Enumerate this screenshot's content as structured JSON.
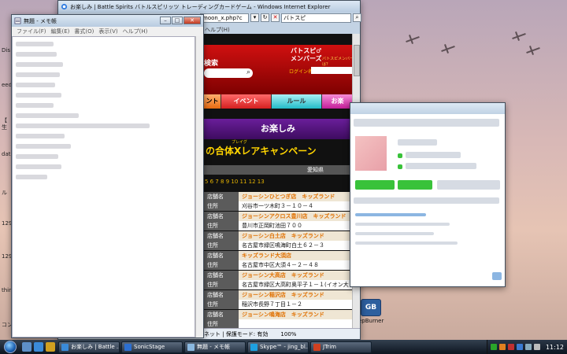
{
  "desktop": {
    "left_labels": [
      "Dis",
      "eed",
      "【",
      "生",
      "dat",
      "ル",
      "129",
      "129",
      "thin",
      "コン"
    ],
    "right_labels": [
      "GB",
      "epBurner"
    ]
  },
  "ie": {
    "title": "お楽しみ | Battle Spirits バトルスピリッツ トレーディングカードゲーム - Windows Internet Explorer",
    "url_tail": "moon_x.php?c",
    "search_tab": "バトスピ",
    "menu_help": "ヘルプ(H)",
    "banner_search": "検索",
    "member_title": "バトスピ♂",
    "member_subtitle": "メンバーズ",
    "member_link": "バトスピメンバーズとは？",
    "login_label": "ログイン名",
    "nav": [
      "ント",
      "イベント",
      "ルール",
      "お楽"
    ],
    "section_title": "お楽しみ",
    "campaign_ruby": "プレイグ",
    "campaign_title": "の合体Xレアキャンペーン",
    "area_header": "愛知県",
    "pages": "5 6 7 8 9 10 11 12 13",
    "stores": [
      {
        "k1": "店舗名",
        "name": "ジョーシンひとつぎ店　キッズランド",
        "k2": "住所",
        "addr": "刈谷市一ツ木町３－１０－４"
      },
      {
        "k1": "店舗名",
        "name": "ジョーシンアクロス豊川店　キッズランド",
        "k2": "住所",
        "addr": "豊川市正岡町池田７００"
      },
      {
        "k1": "店舗名",
        "name": "ジョーシン白土店　キッズランド",
        "k2": "住所",
        "addr": "名古屋市緑区鳴海町白土６２－３"
      },
      {
        "k1": "店舗名",
        "name": "キッズランド大須店",
        "k2": "住所",
        "addr": "名古屋市中区大須４－２－４８"
      },
      {
        "k1": "店舗名",
        "name": "ジョーシン大高店　キッズランド",
        "k2": "住所",
        "addr": "名古屋市緑区大高町奥平子１－１(イオン大高"
      },
      {
        "k1": "店舗名",
        "name": "ジョーシン稲沢店　キッズランド",
        "k2": "住所",
        "addr": "稲沢市長野７丁目１－２"
      },
      {
        "k1": "店舗名",
        "name": "ジョーシン鳴海店　キッズランド",
        "k2": "住所",
        "addr": ""
      }
    ],
    "status_text": "ネット | 保護モード: 有効",
    "zoom": "100%"
  },
  "notepad": {
    "title": "無題 - メモ帳",
    "menu": [
      "ファイル(F)",
      "編集(E)",
      "書式(O)",
      "表示(V)",
      "ヘルプ(H)"
    ],
    "blur_lines": [
      48,
      52,
      60,
      56,
      50,
      58,
      48,
      80,
      170,
      62,
      70,
      54,
      58,
      40
    ]
  },
  "taskbar": {
    "tasks": [
      {
        "label": "お楽しみ | Battle ...",
        "color": "#3a8ad8"
      },
      {
        "label": "SonicStage",
        "color": "#2c6fd0"
      },
      {
        "label": "無題 - メモ帳",
        "color": "#8ab8e0"
      },
      {
        "label": "Skype™ - jing_bl...",
        "color": "#1ea0e0"
      },
      {
        "label": "JTrim",
        "color": "#d04020"
      }
    ],
    "clock": "11:12"
  }
}
